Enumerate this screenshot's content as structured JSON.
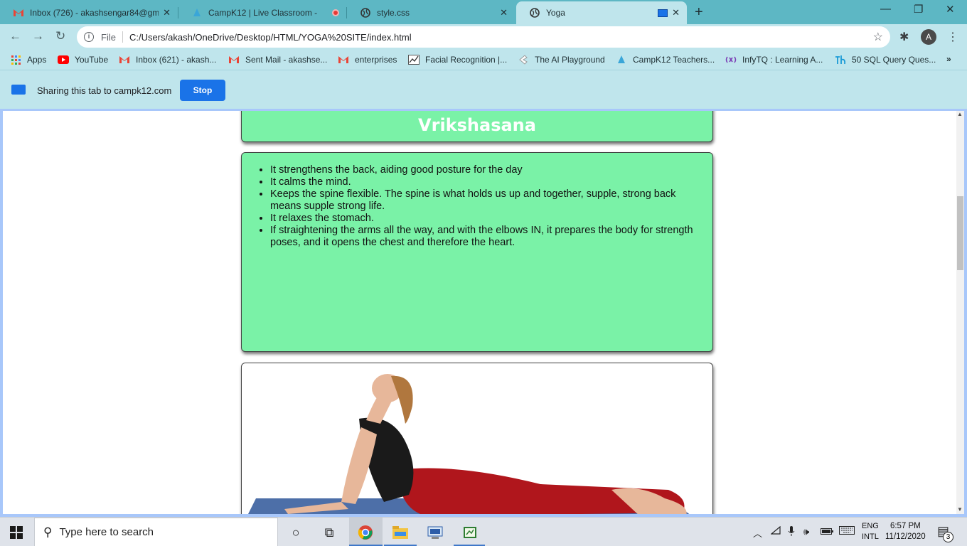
{
  "browser": {
    "tabs": [
      {
        "title": "Inbox (726) - akashsengar84@gm",
        "icon": "gmail-icon",
        "active": false
      },
      {
        "title": "CampK12 | Live Classroom -",
        "icon": "campk12-icon",
        "active": false,
        "recording": true
      },
      {
        "title": "style.css",
        "icon": "globe-icon",
        "active": false
      },
      {
        "title": "Yoga",
        "icon": "globe-icon",
        "active": true,
        "casting": true
      }
    ],
    "new_tab": "+",
    "address": {
      "scheme_label": "File",
      "url": "C:/Users/akash/OneDrive/Desktop/HTML/YOGA%20SITE/index.html"
    },
    "profile_initial": "A",
    "bookmarks": [
      {
        "label": "Apps",
        "icon": "apps-grid-icon"
      },
      {
        "label": "YouTube",
        "icon": "youtube-icon"
      },
      {
        "label": "Inbox (621) - akash...",
        "icon": "gmail-icon"
      },
      {
        "label": "Sent Mail - akashse...",
        "icon": "gmail-icon"
      },
      {
        "label": "enterprises",
        "icon": "gmail-icon"
      },
      {
        "label": "Facial Recognition |...",
        "icon": "chart-icon"
      },
      {
        "label": "The AI Playground",
        "icon": "ai-playground-icon"
      },
      {
        "label": "CampK12 Teachers...",
        "icon": "campk12-icon"
      },
      {
        "label": "InfyTQ : Learning A...",
        "icon": "infytq-icon"
      },
      {
        "label": "50 SQL Query Ques...",
        "icon": "sql-icon"
      }
    ],
    "more_bookmarks": "»",
    "sharing": {
      "text": "Sharing this tab to campk12.com",
      "stop_label": "Stop"
    }
  },
  "page": {
    "pose_title": "Vrikshasana",
    "benefits": [
      "It strengthens the back, aiding good posture for the day",
      "It calms the mind.",
      "Keeps the spine flexible. The spine is what holds us up and together, supple, strong back means supple strong life.",
      "It relaxes the stomach.",
      "If straightening the arms all the way, and with the elbows IN, it prepares the body for strength poses, and it opens the chest and therefore the heart."
    ],
    "card_color": "#7af2a7"
  },
  "taskbar": {
    "search_placeholder": "Type here to search",
    "lang_line1": "ENG",
    "lang_line2": "INTL",
    "time": "6:57 PM",
    "date": "11/12/2020",
    "notification_count": "3"
  }
}
